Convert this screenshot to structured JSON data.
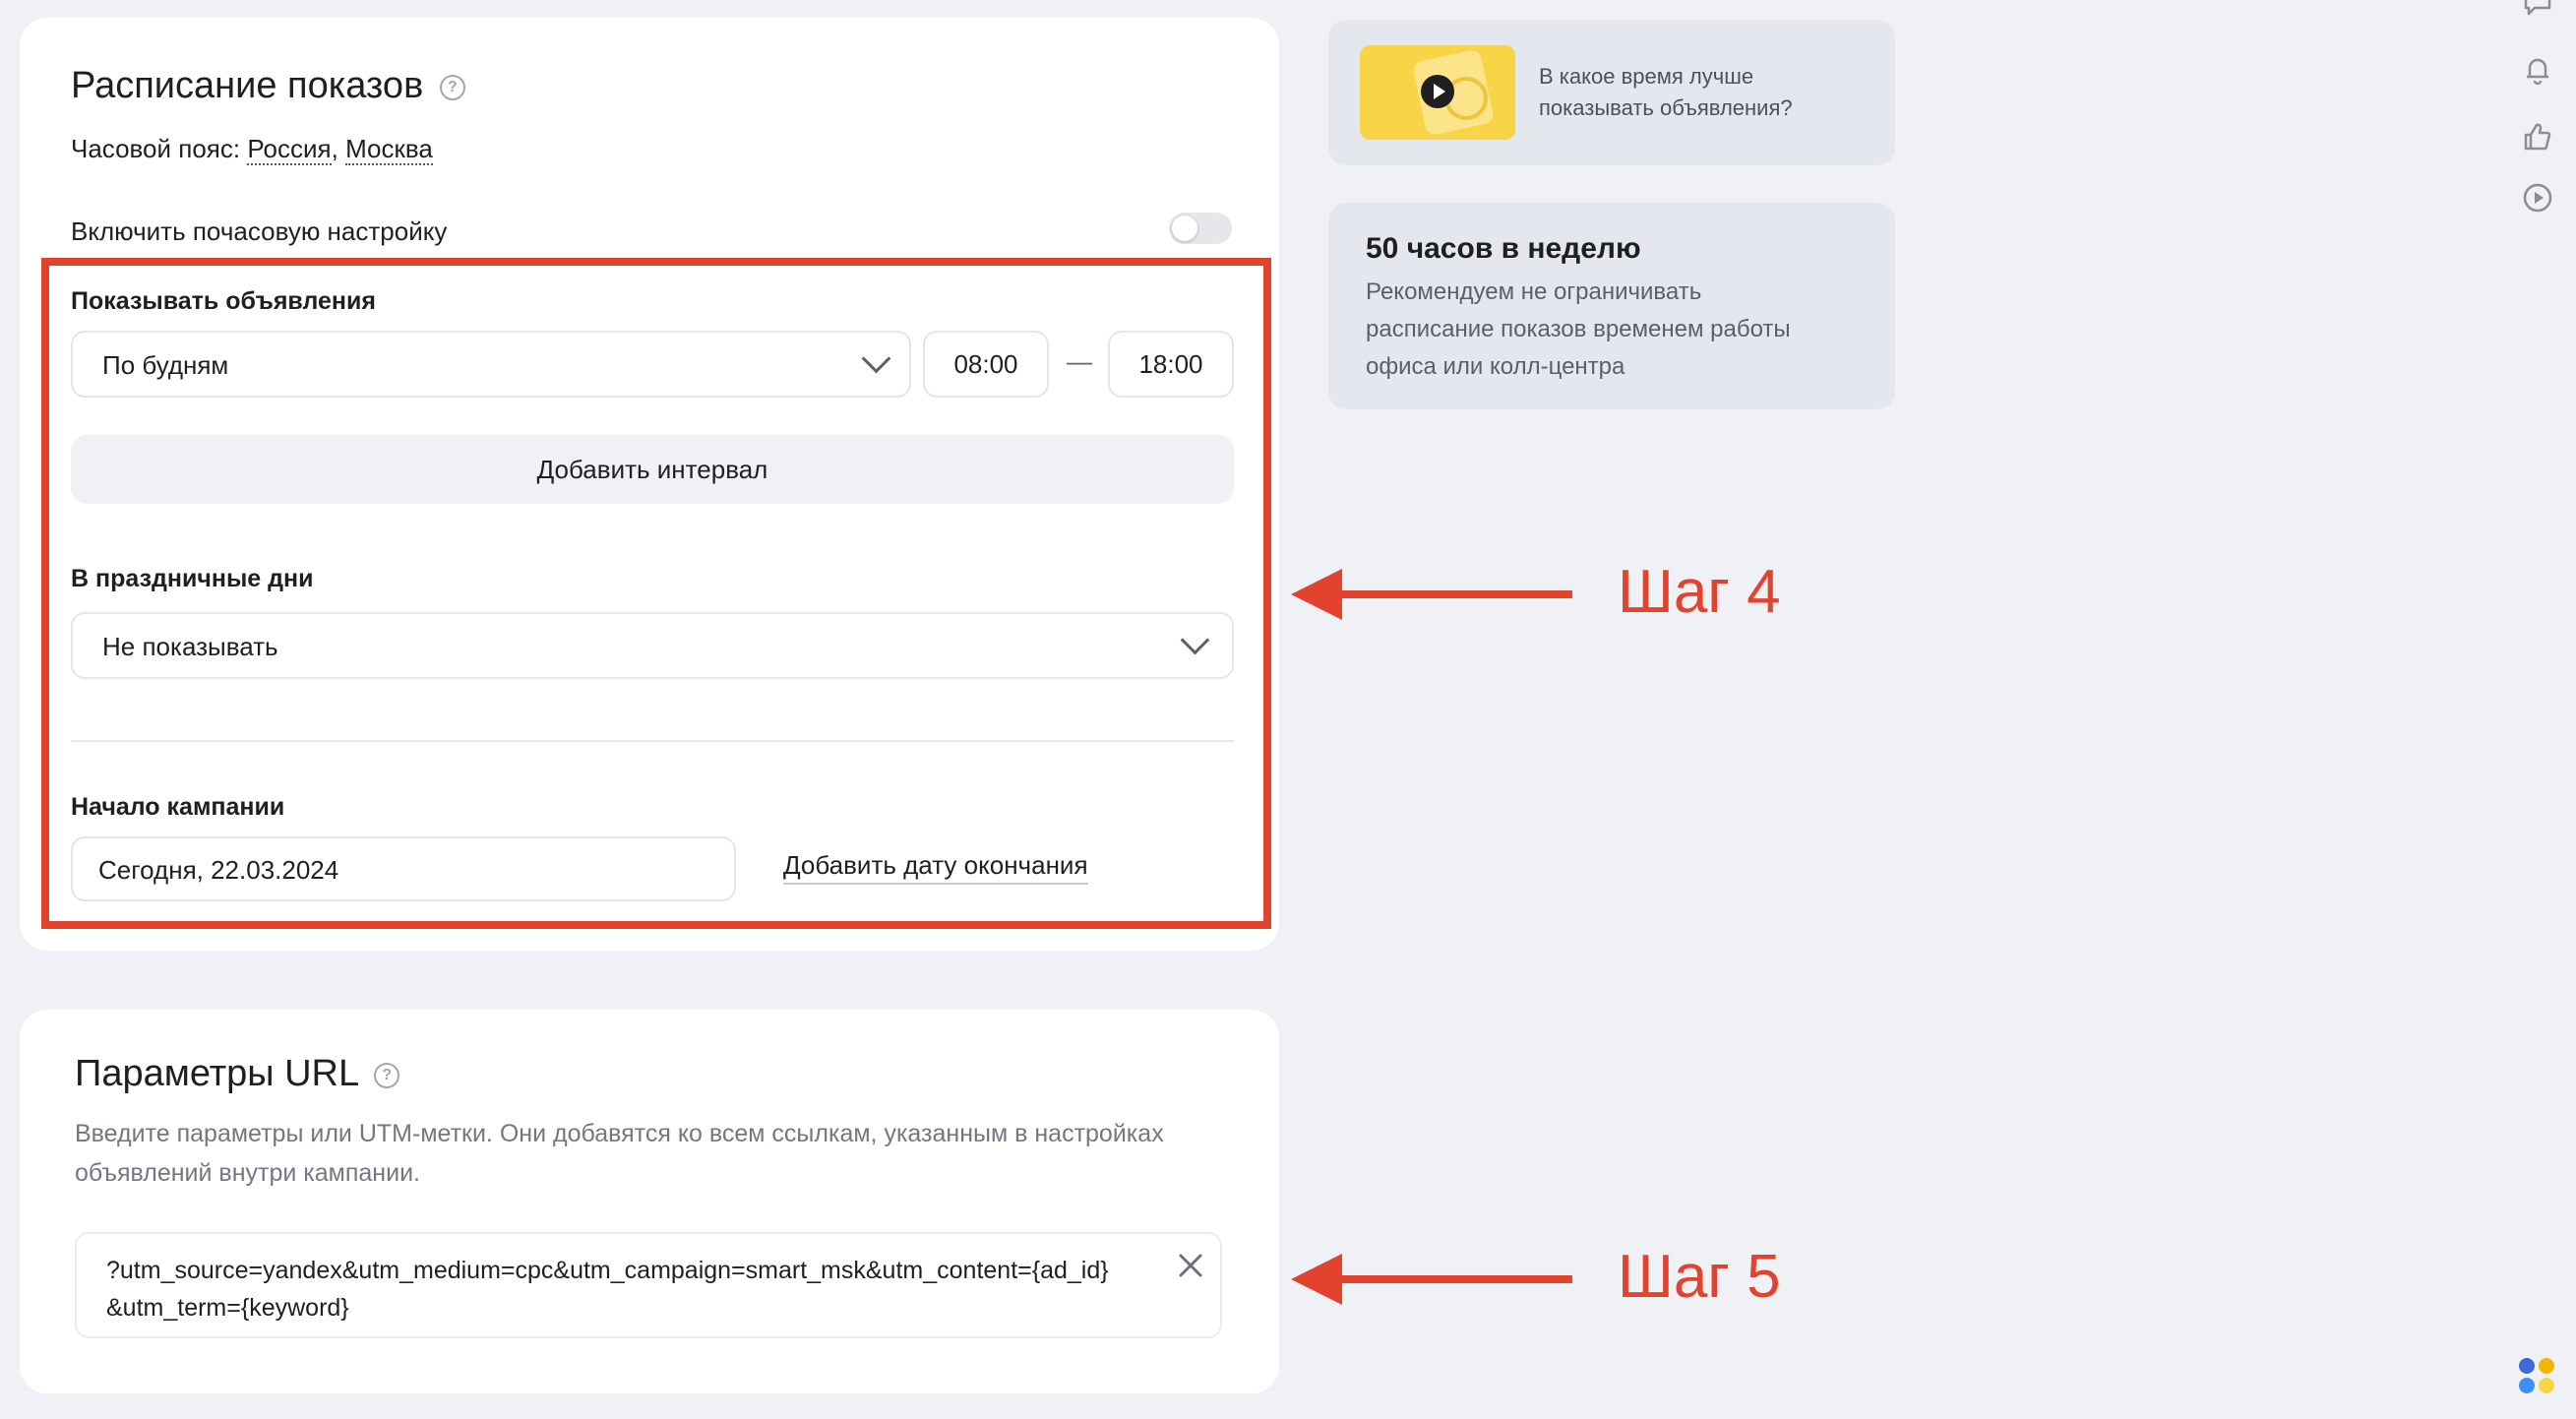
{
  "schedule": {
    "title": "Расписание показов",
    "timezone_label": "Часовой пояс:",
    "timezone_country": "Россия",
    "timezone_sep": ",",
    "timezone_city": "Москва",
    "hourly_toggle_label": "Включить почасовую настройку",
    "show_ads_label": "Показывать объявления",
    "days_select": "По будням",
    "time_from": "08:00",
    "time_dash": "—",
    "time_to": "18:00",
    "add_interval": "Добавить интервал",
    "holidays_label": "В праздничные дни",
    "holidays_select": "Не показывать",
    "start_label": "Начало кампании",
    "start_value": "Сегодня, 22.03.2024",
    "add_end_date": "Добавить дату окончания"
  },
  "url_params": {
    "title": "Параметры URL",
    "description_line1": "Введите параметры или UTM-метки. Они добавятся ко всем ссылкам, указанным в настройках",
    "description_line2": "объявлений внутри кампании.",
    "value_line1": "?utm_source=yandex&utm_medium=cpc&utm_campaign=smart_msk&utm_content={ad_id}",
    "value_line2": "&utm_term={keyword}"
  },
  "tips": {
    "video_line1": "В какое время лучше",
    "video_line2": "показывать объявления?",
    "hours_title": "50 часов в неделю",
    "hours_line1": "Рекомендуем не ограничивать",
    "hours_line2": "расписание показов временем работы",
    "hours_line3": "офиса или колл-центра"
  },
  "annotations": {
    "step4": "Шаг 4",
    "step5": "Шаг 5"
  },
  "colors": {
    "annotation": "#e2432f",
    "background": "#f0f1f5",
    "video_thumb": "#f7d547"
  }
}
